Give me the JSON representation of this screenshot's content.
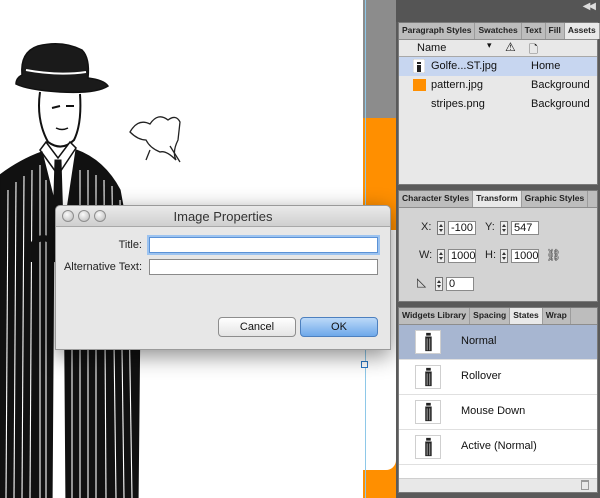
{
  "dialog": {
    "title": "Image Properties",
    "title_label": "Title:",
    "title_value": "",
    "alt_label": "Alternative Text:",
    "alt_value": "",
    "cancel_label": "Cancel",
    "ok_label": "OK"
  },
  "assets_panel": {
    "tabs": [
      {
        "label": "Paragraph Styles",
        "active": false
      },
      {
        "label": "Swatches",
        "active": false
      },
      {
        "label": "Text",
        "active": false
      },
      {
        "label": "Fill",
        "active": false
      },
      {
        "label": "Assets",
        "active": true
      }
    ],
    "column_name": "Name",
    "rows": [
      {
        "name": "Golfe...ST.jpg",
        "location": "Home",
        "selected": true,
        "thumb": "image-thumb-icon"
      },
      {
        "name": "pattern.jpg",
        "location": "Background",
        "selected": false,
        "thumb": "orange-swatch-icon",
        "color": "#ff8f00"
      },
      {
        "name": "stripes.png",
        "location": "Background",
        "selected": false,
        "thumb": "none"
      }
    ]
  },
  "transform_panel": {
    "tabs": [
      {
        "label": "Character Styles",
        "active": false
      },
      {
        "label": "Transform",
        "active": true
      },
      {
        "label": "Graphic Styles",
        "active": false
      }
    ],
    "x_label": "X:",
    "x_value": "-100",
    "y_label": "Y:",
    "y_value": "547",
    "w_label": "W:",
    "w_value": "1000",
    "h_label": "H:",
    "h_value": "1000",
    "angle_value": "0"
  },
  "states_panel": {
    "tabs": [
      {
        "label": "Widgets Library",
        "active": false
      },
      {
        "label": "Spacing",
        "active": false
      },
      {
        "label": "States",
        "active": true
      },
      {
        "label": "Wrap",
        "active": false
      }
    ],
    "states": [
      {
        "label": "Normal",
        "selected": true
      },
      {
        "label": "Rollover",
        "selected": false
      },
      {
        "label": "Mouse Down",
        "selected": false
      },
      {
        "label": "Active (Normal)",
        "selected": false
      }
    ]
  },
  "colors": {
    "accent_orange": "#ff8f00",
    "selection_blue": "#c7d6f0",
    "state_selected": "#a7b6d1",
    "ok_button": "#6ea8ea"
  }
}
